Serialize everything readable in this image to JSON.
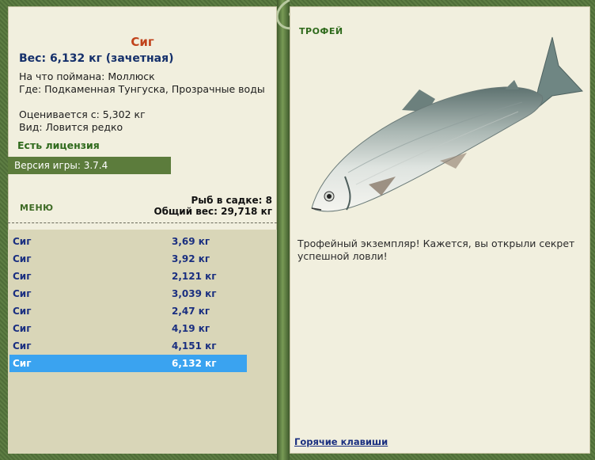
{
  "fish": {
    "title": "Сиг",
    "weight_line": "Вес: 6,132 кг (зачетная)",
    "bait_line": "На что поймана: Моллюск",
    "location_line": "Где: Подкаменная Тунгуска, Прозрачные воды",
    "estimate_line": "Оценивается с: 5,302 кг",
    "species_line": "Вид: Ловится редко",
    "license": "Есть лицензия"
  },
  "game": {
    "version": "Версия игры: 3.7.4"
  },
  "menu": {
    "label": "МЕНЮ"
  },
  "cage": {
    "count_line": "Рыб в садке: 8",
    "total_weight_line": "Общий вес: 29,718 кг"
  },
  "catch_list": [
    {
      "name": "Сиг",
      "weight": "3,69 кг"
    },
    {
      "name": "Сиг",
      "weight": "3,92 кг"
    },
    {
      "name": "Сиг",
      "weight": "2,121 кг"
    },
    {
      "name": "Сиг",
      "weight": "3,039 кг"
    },
    {
      "name": "Сиг",
      "weight": "2,47 кг"
    },
    {
      "name": "Сиг",
      "weight": "4,19 кг"
    },
    {
      "name": "Сиг",
      "weight": "4,151 кг"
    },
    {
      "name": "Сиг",
      "weight": "6,132 кг"
    }
  ],
  "selected_index": 7,
  "trophy": {
    "title": "ТРОФЕЙ",
    "text": "Трофейный экземпляр! Кажется, вы открыли секрет успешной ловли!"
  },
  "hotkeys_label": "Горячие клавиши",
  "colors": {
    "frame_green": "#5a7a40",
    "panel_bg": "#f1efde",
    "list_bg": "#d9d6b8",
    "selection_blue": "#3aa3f0",
    "title_orange": "#c0421a",
    "text_navy": "#15306b"
  }
}
